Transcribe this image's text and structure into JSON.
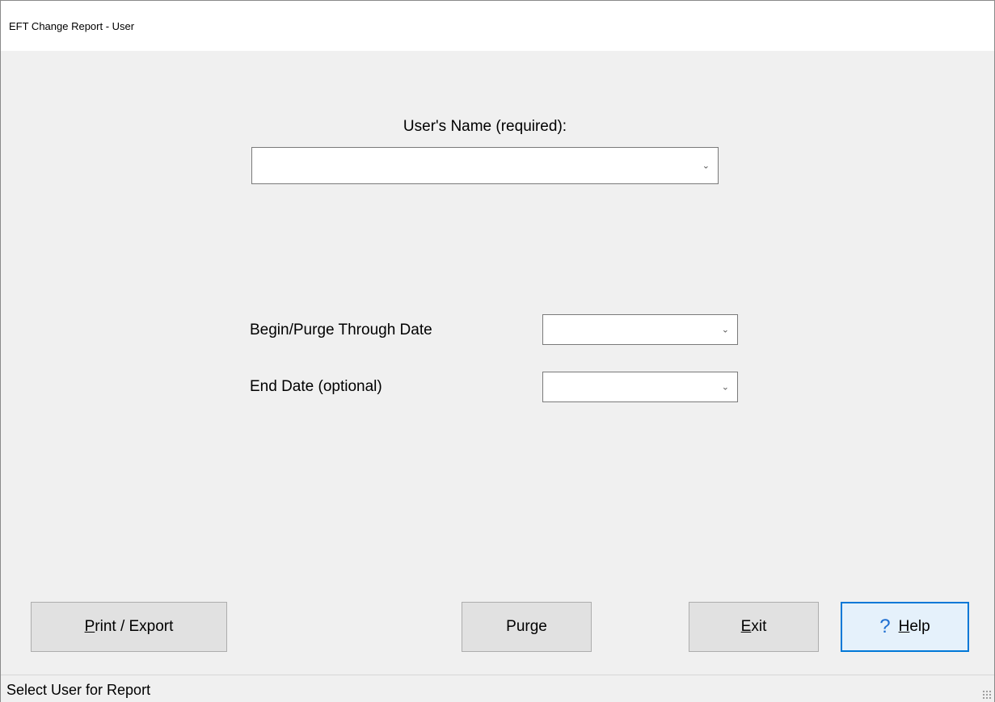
{
  "window": {
    "title": "EFT Change Report - User"
  },
  "form": {
    "user_label": "User's Name (required):",
    "user_value": "",
    "begin_label": "Begin/Purge Through Date",
    "begin_value": "",
    "end_label": "End Date (optional)",
    "end_value": ""
  },
  "buttons": {
    "print_export": {
      "mnemonic": "P",
      "rest": "rint / Export"
    },
    "purge": {
      "label": "Purge"
    },
    "exit": {
      "mnemonic": "E",
      "rest": "xit"
    },
    "help": {
      "mnemonic": "H",
      "rest": "elp",
      "icon": "question-icon",
      "glyph": "?"
    }
  },
  "dropdown_glyph": "⌄",
  "status": {
    "text": "Select User for Report"
  },
  "colors": {
    "background": "#f0f0f0",
    "focus_border": "#0078d7",
    "help_icon": "#1e6fd1"
  }
}
